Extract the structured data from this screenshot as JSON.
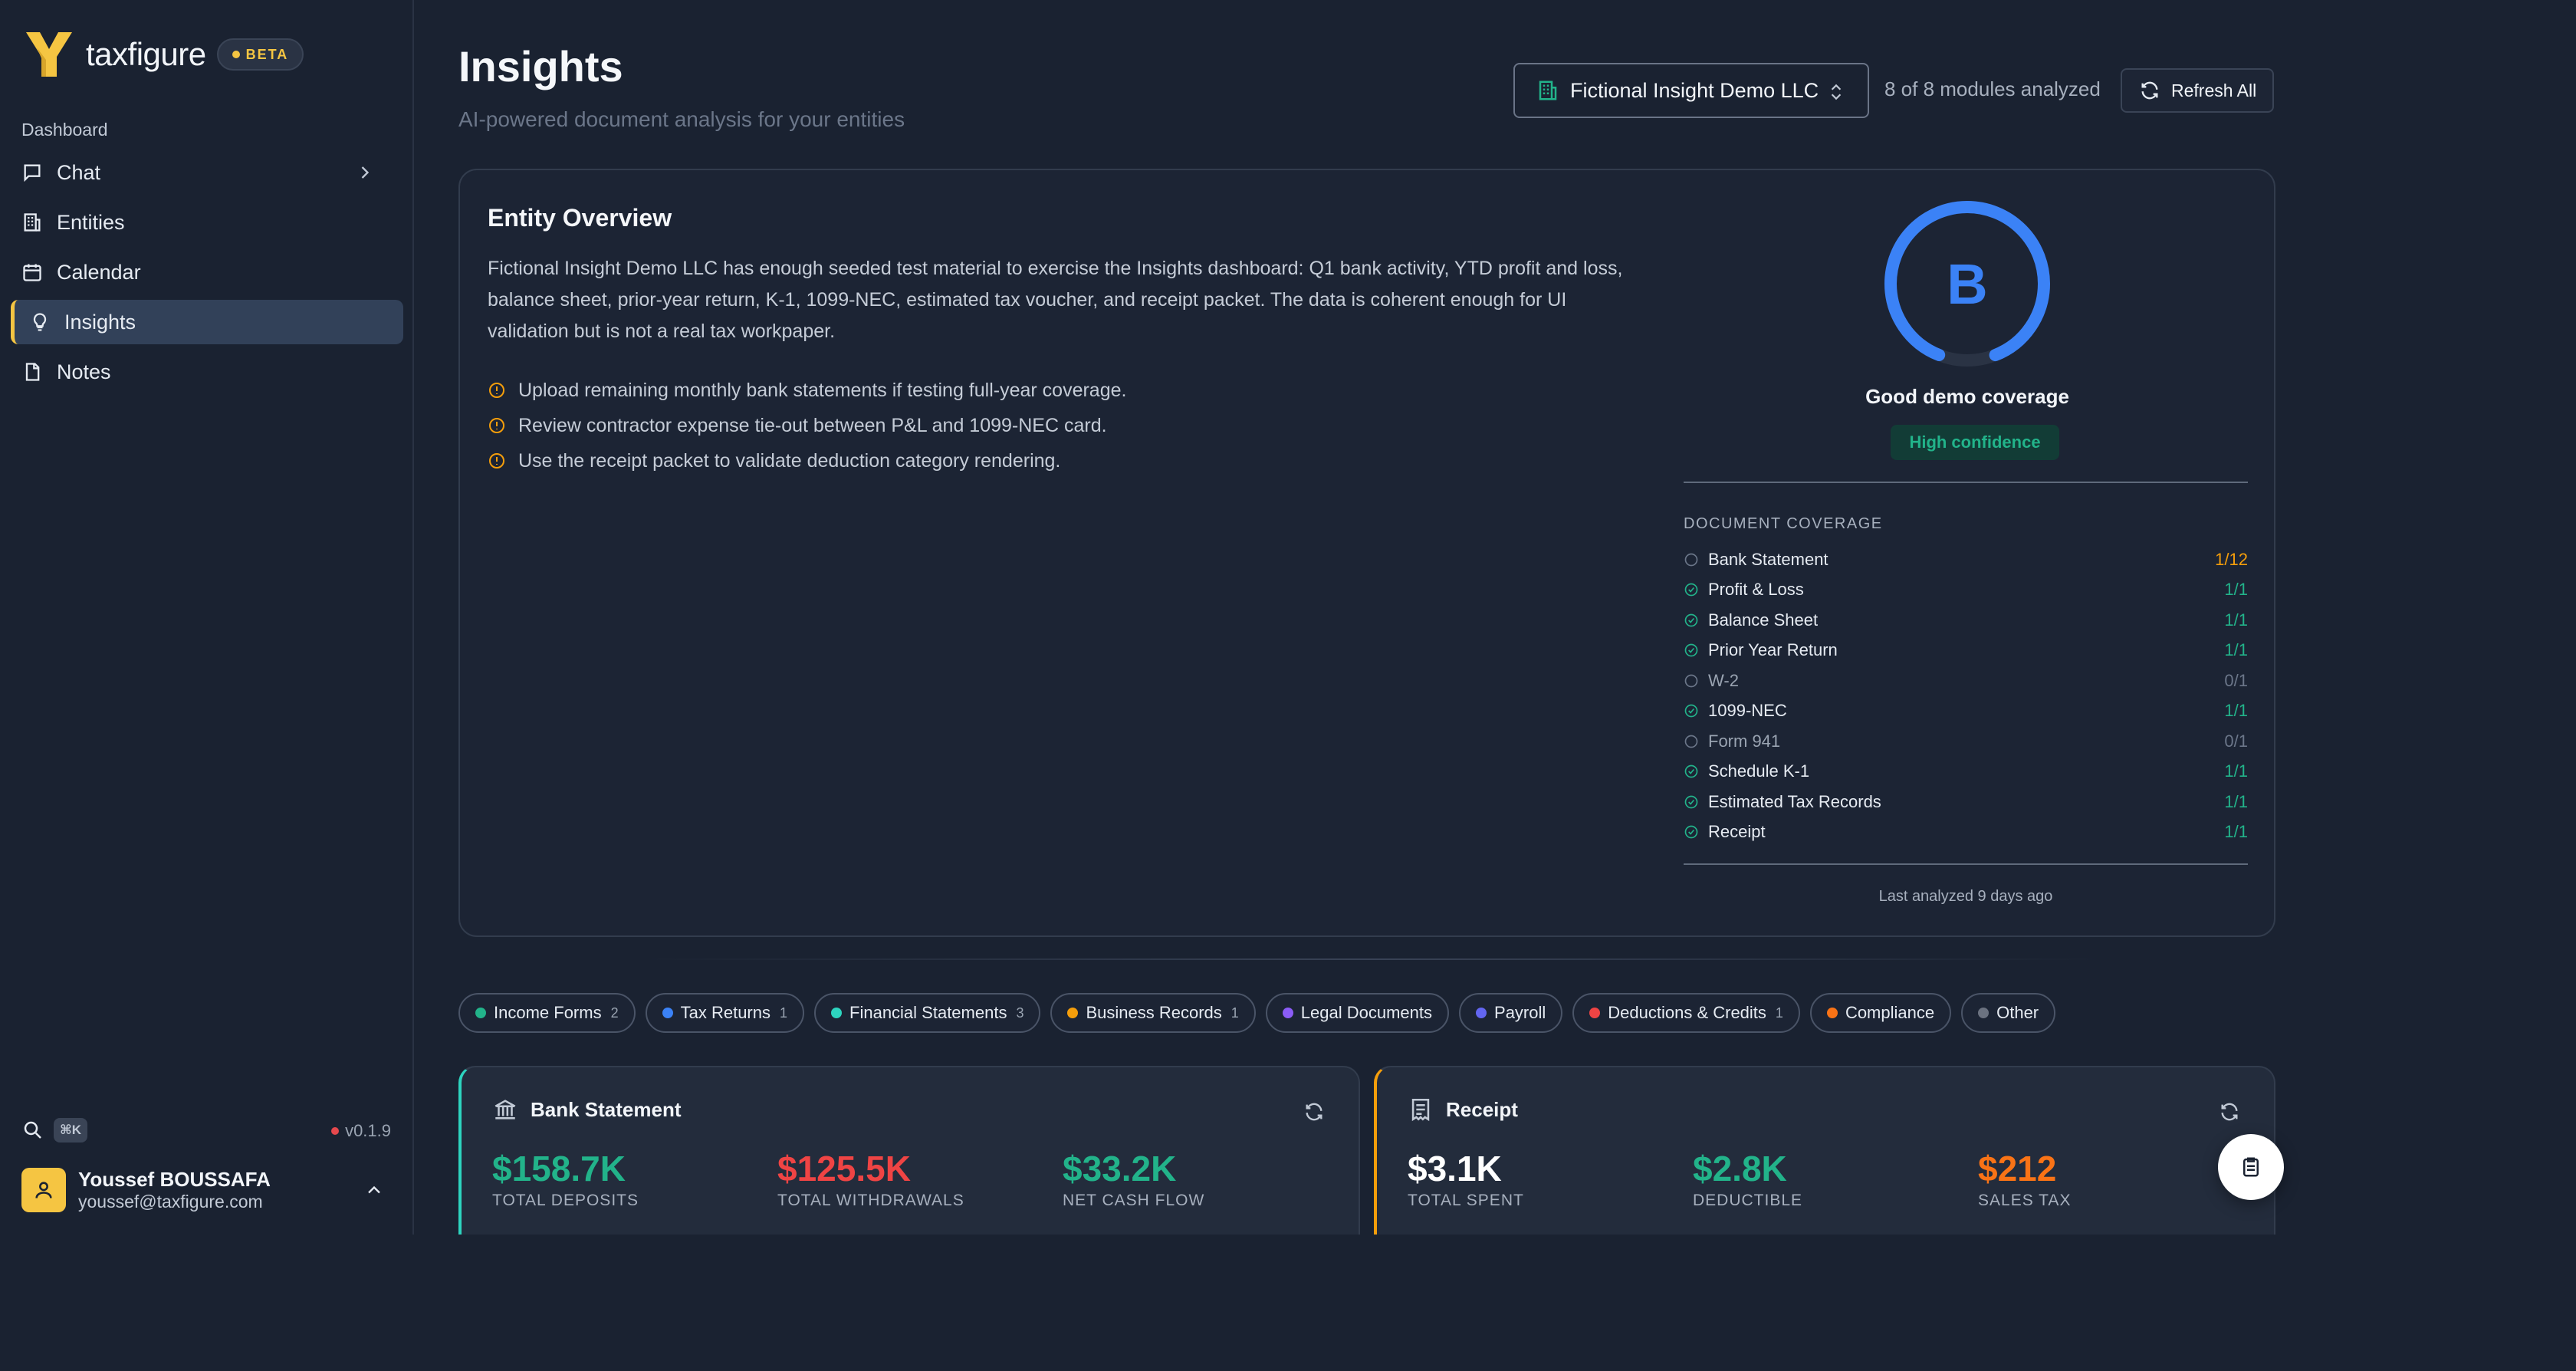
{
  "brand": {
    "name": "taxfigure",
    "badge": "BETA"
  },
  "sidebar": {
    "section": "Dashboard",
    "items": [
      {
        "label": "Chat"
      },
      {
        "label": "Entities"
      },
      {
        "label": "Calendar"
      },
      {
        "label": "Insights",
        "active": true
      },
      {
        "label": "Notes"
      }
    ],
    "shortcut": "⌘K",
    "version": "v0.1.9",
    "user": {
      "name": "Youssef BOUSSAFA",
      "email": "youssef@taxfigure.com"
    }
  },
  "header": {
    "title": "Insights",
    "subtitle": "AI-powered document analysis for your entities",
    "entity": "Fictional Insight Demo LLC",
    "modules": "8 of 8 modules analyzed",
    "refresh_label": "Refresh All"
  },
  "overview": {
    "title": "Entity Overview",
    "description": "Fictional Insight Demo LLC has enough seeded test material to exercise the Insights dashboard: Q1 bank activity, YTD profit and loss, balance sheet, prior-year return, K-1, 1099-NEC, estimated tax voucher, and receipt packet. The data is coherent enough for UI validation but is not a real tax workpaper.",
    "recommendations": [
      "Upload remaining monthly bank statements if testing full-year coverage.",
      "Review contractor expense tie-out between P&L and 1099-NEC card.",
      "Use the receipt packet to validate deduction category rendering."
    ],
    "grade": "B",
    "grade_progress": 0.88,
    "grade_label": "Good demo coverage",
    "confidence": "High confidence",
    "coverage_title": "DOCUMENT COVERAGE",
    "coverage": [
      {
        "name": "Bank Statement",
        "value": "1/12",
        "status": "partial"
      },
      {
        "name": "Profit & Loss",
        "value": "1/1",
        "status": "complete"
      },
      {
        "name": "Balance Sheet",
        "value": "1/1",
        "status": "complete"
      },
      {
        "name": "Prior Year Return",
        "value": "1/1",
        "status": "complete"
      },
      {
        "name": "W-2",
        "value": "0/1",
        "status": "missing"
      },
      {
        "name": "1099-NEC",
        "value": "1/1",
        "status": "complete"
      },
      {
        "name": "Form 941",
        "value": "0/1",
        "status": "missing"
      },
      {
        "name": "Schedule K-1",
        "value": "1/1",
        "status": "complete"
      },
      {
        "name": "Estimated Tax Records",
        "value": "1/1",
        "status": "complete"
      },
      {
        "name": "Receipt",
        "value": "1/1",
        "status": "complete"
      }
    ],
    "last_analyzed": "Last analyzed 9 days ago"
  },
  "filters": [
    {
      "label": "Income Forms",
      "count": "2",
      "color": "#22b38a"
    },
    {
      "label": "Tax Returns",
      "count": "1",
      "color": "#3b82f6"
    },
    {
      "label": "Financial Statements",
      "count": "3",
      "color": "#2dd4bf"
    },
    {
      "label": "Business Records",
      "count": "1",
      "color": "#f59e0b"
    },
    {
      "label": "Legal Documents",
      "count": "",
      "color": "#8b5cf6"
    },
    {
      "label": "Payroll",
      "count": "",
      "color": "#6366f1"
    },
    {
      "label": "Deductions & Credits",
      "count": "1",
      "color": "#ef4444"
    },
    {
      "label": "Compliance",
      "count": "",
      "color": "#f97316"
    },
    {
      "label": "Other",
      "count": "",
      "color": "#6b7280"
    }
  ],
  "cards": [
    {
      "title": "Bank Statement",
      "accent": "#2dd4bf",
      "metrics": [
        {
          "value": "$158.7K",
          "label": "TOTAL DEPOSITS",
          "color": "#22b38a"
        },
        {
          "value": "$125.5K",
          "label": "TOTAL WITHDRAWALS",
          "color": "#ef4444"
        },
        {
          "value": "$33.2K",
          "label": "NET CASH FLOW",
          "color": "#22b38a"
        }
      ]
    },
    {
      "title": "Receipt",
      "accent": "#f59e0b",
      "metrics": [
        {
          "value": "$3.1K",
          "label": "TOTAL SPENT",
          "color": "#ffffff"
        },
        {
          "value": "$2.8K",
          "label": "DEDUCTIBLE",
          "color": "#22b38a"
        },
        {
          "value": "$212",
          "label": "SALES TAX",
          "color": "#f97316"
        }
      ]
    }
  ],
  "colors": {
    "accent": "#f5c542",
    "primary": "#3b82f6",
    "success": "#22b38a",
    "warning": "#f59e0b",
    "danger": "#ef4444"
  }
}
